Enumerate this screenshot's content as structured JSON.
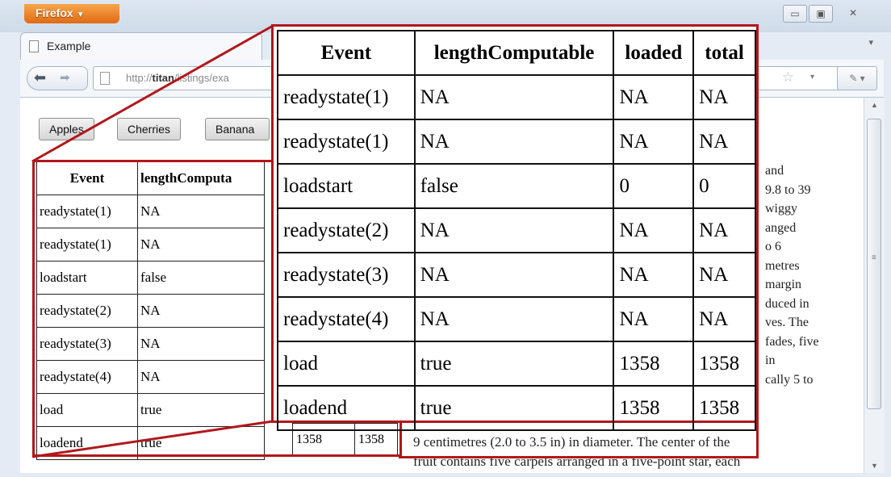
{
  "browser": {
    "app_button": "Firefox",
    "tab_title": "Example",
    "url": {
      "prefix": "http://",
      "host": "titan",
      "path": "/listings/exa"
    },
    "controls": [
      "minimize-icon",
      "maximize-icon",
      "close-icon"
    ]
  },
  "buttons": [
    "Apples",
    "Cherries",
    "Banana"
  ],
  "table": {
    "headers": [
      "Event",
      "lengthComputable",
      "loaded",
      "total"
    ],
    "rows": [
      [
        "readystate(1)",
        "NA",
        "NA",
        "NA"
      ],
      [
        "readystate(1)",
        "NA",
        "NA",
        "NA"
      ],
      [
        "loadstart",
        "false",
        "0",
        "0"
      ],
      [
        "readystate(2)",
        "NA",
        "NA",
        "NA"
      ],
      [
        "readystate(3)",
        "NA",
        "NA",
        "NA"
      ],
      [
        "readystate(4)",
        "NA",
        "NA",
        "NA"
      ],
      [
        "load",
        "true",
        "1358",
        "1358"
      ],
      [
        "loadend",
        "true",
        "1358",
        "1358"
      ]
    ],
    "small_header_partial": "lengthComputa"
  },
  "side_text": [
    "and",
    "9.8 to 39",
    "wiggy",
    "anged",
    "o 6",
    "metres",
    "margin",
    "duced in",
    "ves. The",
    "fades, five",
    "in",
    "cally 5 to"
  ],
  "bottom_text": [
    "9 centimetres (2.0 to 3.5 in) in diameter. The center of the",
    "fruit contains five carpels arranged in a five-point star, each"
  ],
  "colors": {
    "highlight": "#b2171b",
    "firefox_button": "#e57a1c"
  }
}
